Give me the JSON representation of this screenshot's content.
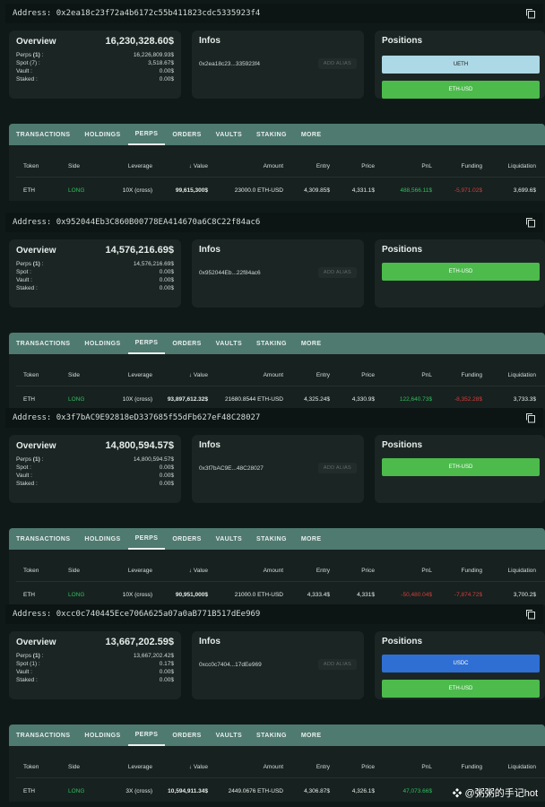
{
  "tabs": [
    "TRANSACTIONS",
    "HOLDINGS",
    "PERPS",
    "ORDERS",
    "VAULTS",
    "STAKING",
    "MORE"
  ],
  "headers": {
    "token": "Token",
    "side": "Side",
    "leverage": "Leverage",
    "value": "↓ Value",
    "amount": "Amount",
    "entry": "Entry",
    "price": "Price",
    "pnl": "PnL",
    "funding": "Funding",
    "liquidation": "Liquidation"
  },
  "labels": {
    "overview": "Overview",
    "infos": "Infos",
    "positions": "Positions",
    "add_alias": "ADD ALIAS",
    "perps": "Perps",
    "spot": "Spot :",
    "vault": "Vault :",
    "staked": "Staked :"
  },
  "wallets": [
    {
      "address": "Address: 0x2ea18c23f72a4b6172c55b411823cdc5335923f4",
      "total": "16,230,328.60$",
      "perps_count": "(1)",
      "perps": "16,226,809.93$",
      "spot_label": "Spot (7) :",
      "spot": "3,518.67$",
      "vault": "0.00$",
      "staked": "0.00$",
      "info_addr": "0x2ea18c23...335923f4",
      "positions": [
        {
          "label": "UETH",
          "color": "#add8e6",
          "text": "#1a1a1a"
        },
        {
          "label": "ETH-USD",
          "color": "#4cbb4c",
          "text": "#ffffff"
        }
      ],
      "row": {
        "token": "ETH",
        "side": "LONG",
        "leverage": "10X (cross)",
        "value": "99,615,300$",
        "amount": "23000.0 ETH-USD",
        "entry": "4,309.85$",
        "price": "4,331.1$",
        "pnl": "488,566.11$",
        "pnl_sign": "pos",
        "funding": "-5,971.02$",
        "liquidation": "3,699.6$"
      }
    },
    {
      "address": "Address: 0x952044Eb3C860B00778EA414670a6C8C22f84ac6",
      "total": "14,576,216.69$",
      "perps_count": "(1)",
      "perps": "14,576,216.69$",
      "spot_label": "Spot :",
      "spot": "0.00$",
      "vault": "0.00$",
      "staked": "0.00$",
      "info_addr": "0x952044Eb...22f84ac6",
      "positions": [
        {
          "label": "ETH-USD",
          "color": "#4cbb4c",
          "text": "#ffffff"
        }
      ],
      "row": {
        "token": "ETH",
        "side": "LONG",
        "leverage": "10X (cross)",
        "value": "93,897,612.32$",
        "amount": "21680.8544 ETH-USD",
        "entry": "4,325.24$",
        "price": "4,330.9$",
        "pnl": "122,640.73$",
        "pnl_sign": "pos",
        "funding": "-8,352.28$",
        "liquidation": "3,733.3$"
      }
    },
    {
      "address": "Address: 0x3f7bAC9E92818eD337685f55dFb627eF48C28027",
      "total": "14,800,594.57$",
      "perps_count": "(1)",
      "perps": "14,800,594.57$",
      "spot_label": "Spot :",
      "spot": "0.00$",
      "vault": "0.00$",
      "staked": "0.00$",
      "info_addr": "0x3f7bAC9E...48C28027",
      "positions": [
        {
          "label": "ETH-USD",
          "color": "#4cbb4c",
          "text": "#ffffff"
        }
      ],
      "row": {
        "token": "ETH",
        "side": "LONG",
        "leverage": "10X (cross)",
        "value": "90,951,000$",
        "amount": "21000.0 ETH-USD",
        "entry": "4,333.4$",
        "price": "4,331$",
        "pnl": "-50,480.04$",
        "pnl_sign": "neg",
        "funding": "-7,874.72$",
        "liquidation": "3,700.2$"
      }
    },
    {
      "address": "Address: 0xcc0c740445Ece706A625a07a0aB771B517dEe969",
      "total": "13,667,202.59$",
      "perps_count": "(1)",
      "perps": "13,667,202.42$",
      "spot_label": "Spot (1) :",
      "spot": "0.17$",
      "vault": "0.00$",
      "staked": "0.00$",
      "info_addr": "0xcc0c7404...17dEe969",
      "positions": [
        {
          "label": "USDC",
          "color": "#2f6fd4",
          "text": "#ffffff"
        },
        {
          "label": "ETH-USD",
          "color": "#4cbb4c",
          "text": "#ffffff"
        }
      ],
      "row": {
        "token": "ETH",
        "side": "LONG",
        "leverage": "3X (cross)",
        "value": "10,594,911.34$",
        "amount": "2449.0676 ETH-USD",
        "entry": "4,306.87$",
        "price": "4,326.1$",
        "pnl": "47,073.66$",
        "pnl_sign": "pos",
        "funding": "",
        "liquidation": ""
      }
    }
  ],
  "watermark": "❖ @粥粥的手记hot"
}
